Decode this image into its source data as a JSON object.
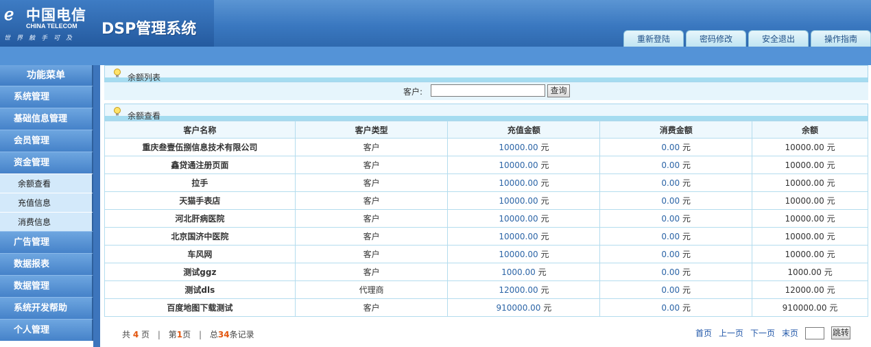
{
  "header": {
    "logo_cn": "中国电信",
    "logo_en": "CHINA TELECOM",
    "logo_slogan": "世界触手可及",
    "system_title": "DSP管理系统",
    "nav_tabs": [
      "重新登陆",
      "密码修改",
      "安全退出",
      "操作指南"
    ]
  },
  "sidebar": {
    "title": "功能菜单",
    "items_before": [
      "系统管理",
      "基础信息管理",
      "会员管理",
      "资金管理"
    ],
    "sub_items": [
      "余额查看",
      "充值信息",
      "消费信息"
    ],
    "items_after": [
      "广告管理",
      "数据报表",
      "数据管理",
      "系统开发帮助",
      "个人管理"
    ]
  },
  "search_panel": {
    "title": "余额列表",
    "label": "客户:",
    "input_value": "",
    "button": "查询"
  },
  "list_panel": {
    "title": "余额查看",
    "columns": [
      "客户名称",
      "客户类型",
      "充值金额",
      "消费金额",
      "余额"
    ],
    "unit": "元",
    "rows": [
      {
        "name": "重庆叁壹伍捌信息技术有限公司",
        "type": "客户",
        "recharge": "10000.00",
        "consume": "0.00",
        "balance": "10000.00"
      },
      {
        "name": "鑫贷通注册页面",
        "type": "客户",
        "recharge": "10000.00",
        "consume": "0.00",
        "balance": "10000.00"
      },
      {
        "name": "拉手",
        "type": "客户",
        "recharge": "10000.00",
        "consume": "0.00",
        "balance": "10000.00"
      },
      {
        "name": "天猫手表店",
        "type": "客户",
        "recharge": "10000.00",
        "consume": "0.00",
        "balance": "10000.00"
      },
      {
        "name": "河北肝病医院",
        "type": "客户",
        "recharge": "10000.00",
        "consume": "0.00",
        "balance": "10000.00"
      },
      {
        "name": "北京国济中医院",
        "type": "客户",
        "recharge": "10000.00",
        "consume": "0.00",
        "balance": "10000.00"
      },
      {
        "name": "车风网",
        "type": "客户",
        "recharge": "10000.00",
        "consume": "0.00",
        "balance": "10000.00"
      },
      {
        "name": "测试ggz",
        "type": "客户",
        "recharge": "1000.00",
        "consume": "0.00",
        "balance": "1000.00"
      },
      {
        "name": "测试dls",
        "type": "代理商",
        "recharge": "12000.00",
        "consume": "0.00",
        "balance": "12000.00"
      },
      {
        "name": "百度地图下载测试",
        "type": "客户",
        "recharge": "910000.00",
        "consume": "0.00",
        "balance": "910000.00"
      }
    ]
  },
  "pager": {
    "total_pages_prefix": "共",
    "total_pages": "4",
    "total_pages_suffix": "页",
    "current_prefix": "第",
    "current_page": "1",
    "current_suffix": "页",
    "records_prefix": "总",
    "total_records": "34",
    "records_suffix": "条记录",
    "first": "首页",
    "prev": "上一页",
    "next": "下一页",
    "last": "末页",
    "jump_value": "",
    "jump_button": "跳转"
  },
  "colors": {
    "header_blue": "#3a78c0",
    "amount_blue": "#2b64a6",
    "pager_highlight": "#e3560f"
  }
}
